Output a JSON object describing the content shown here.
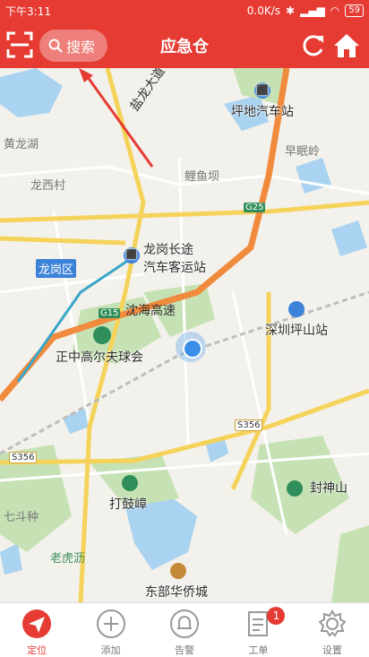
{
  "status_bar": {
    "time": "下午3:11",
    "net_speed": "0.0K/s",
    "battery": "59"
  },
  "header": {
    "search_label": "搜索",
    "title": "应急仓"
  },
  "map": {
    "labels": {
      "yanlong_avenue": "盐龙大道",
      "huanglong_lake": "黄龙湖",
      "longxi_village": "龙西村",
      "xiapu_ridge": "早眠岭",
      "liyu_dam": "鲤鱼坝",
      "pingdi_station": "坪地汽车站",
      "longgang_station_1": "龙岗长途",
      "longgang_station_2": "汽车客运站",
      "longgang_district": "龙岗区",
      "shenhai_expressway": "沈海高速",
      "zhengzhong_golf": "正中高尔夫球会",
      "pingshan_station": "深圳坪山站",
      "dagu_zhang": "打鼓嶂",
      "fengshen_mountain": "封神山",
      "qidou_zhong": "七斗种",
      "laohu_li": "老虎沥",
      "dongbu_huaqiao": "东部华侨城"
    },
    "roads": {
      "g15": "G15",
      "g25": "G25",
      "s356_a": "S356",
      "s356_b": "S356"
    }
  },
  "tabs": [
    {
      "label": "定位",
      "icon": "location-arrow-icon",
      "active": true
    },
    {
      "label": "添加",
      "icon": "add-circle-icon",
      "active": false
    },
    {
      "label": "告警",
      "icon": "bell-icon",
      "active": false
    },
    {
      "label": "工单",
      "icon": "document-icon",
      "active": false,
      "badge": "1"
    },
    {
      "label": "设置",
      "icon": "gear-icon",
      "active": false
    }
  ],
  "colors": {
    "brand": "#e53b33",
    "highway": "#f08a3c",
    "road": "#f5d35a",
    "water": "#a9d3f0",
    "park": "#c6e2b4"
  }
}
